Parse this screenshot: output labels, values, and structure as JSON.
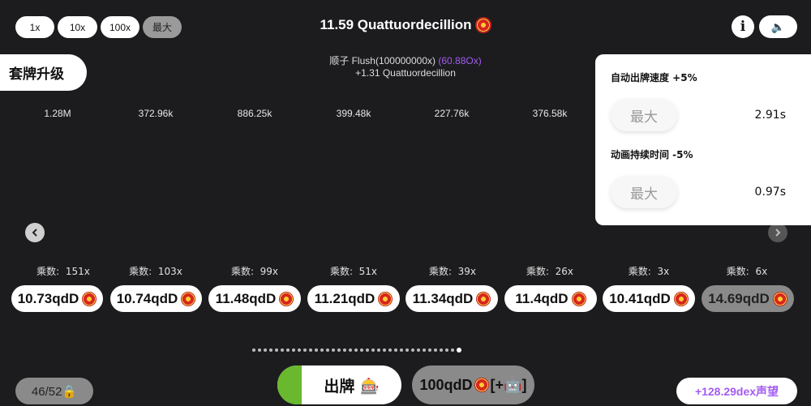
{
  "speed_buttons": [
    "1x",
    "10x",
    "100x",
    "最大"
  ],
  "score": {
    "value": "11.59 Quattuordecillion"
  },
  "info_label": "i",
  "sound_label": "🔈",
  "upgrade_button": "套牌升级",
  "hand": {
    "name": "顺子 Flush(100000000x)",
    "multiplier": "(60.88Ox)",
    "gain": "+1.31 Quattuordecillion"
  },
  "columns": [
    {
      "stat": "1.28M",
      "mult_label": "乘数:",
      "mult": "151x",
      "value": "10.73qdD",
      "active": true
    },
    {
      "stat": "372.96k",
      "mult_label": "乘数:",
      "mult": "103x",
      "value": "10.74qdD",
      "active": true
    },
    {
      "stat": "886.25k",
      "mult_label": "乘数:",
      "mult": "99x",
      "value": "11.48qdD",
      "active": true
    },
    {
      "stat": "399.48k",
      "mult_label": "乘数:",
      "mult": "51x",
      "value": "11.21qdD",
      "active": true
    },
    {
      "stat": "227.76k",
      "mult_label": "乘数:",
      "mult": "39x",
      "value": "11.34qdD",
      "active": true
    },
    {
      "stat": "376.58k",
      "mult_label": "乘数:",
      "mult": "26x",
      "value": "11.4qdD",
      "active": true
    },
    {
      "stat": "",
      "mult_label": "乘数:",
      "mult": "3x",
      "value": "10.41qdD",
      "active": true
    },
    {
      "stat": "",
      "mult_label": "乘数:",
      "mult": "6x",
      "value": "14.69qdD",
      "active": false
    }
  ],
  "settings_panel": {
    "auto_speed_label": "自动出牌速度 +5%",
    "auto_speed_button": "最大",
    "auto_speed_value": "2.91s",
    "anim_label": "动画持续时间 -5%",
    "anim_button": "最大",
    "anim_value": "0.97s"
  },
  "pagination": {
    "total": 37,
    "active_index": 36
  },
  "deck_count": "46/52🔒",
  "play_button": "出牌 🎰",
  "cost_button": {
    "amount": "100qdD",
    "suffix": "[+🤖]"
  },
  "reputation": "+128.29dex声望",
  "colors": {
    "accent_purple": "#a35cf2",
    "play_green": "#6ab82e",
    "background": "#1c1c1e"
  }
}
